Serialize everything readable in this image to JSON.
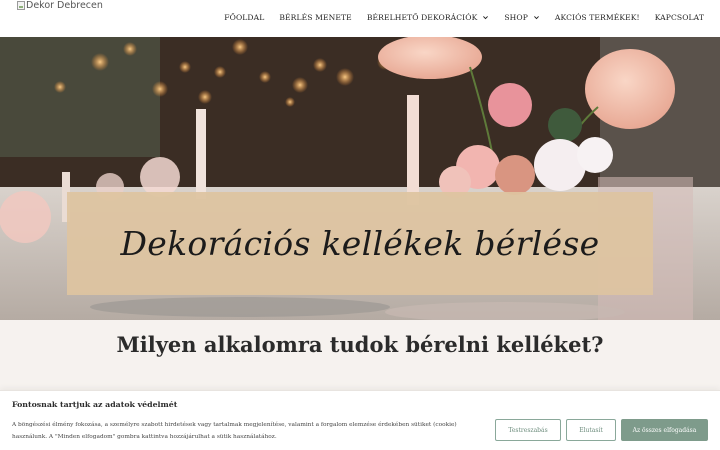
{
  "header": {
    "logo_alt": "Dekor Debrecen",
    "nav": [
      {
        "label": "FŐOLDAL",
        "dropdown": false
      },
      {
        "label": "BÉRLÉS MENETE",
        "dropdown": false
      },
      {
        "label": "BÉRELHETŐ DEKORÁCIÓK",
        "dropdown": true
      },
      {
        "label": "SHOP",
        "dropdown": true
      },
      {
        "label": "AKCIÓS TERMÉKEK!",
        "dropdown": false
      },
      {
        "label": "KAPCSOLAT",
        "dropdown": false
      }
    ]
  },
  "hero": {
    "title": "Dekorációs kellékek bérlése"
  },
  "section": {
    "title": "Milyen alkalomra tudok bérelni kelléket?"
  },
  "cookie": {
    "title": "Fontosnak tartjuk az adatok védelmét",
    "text": "A böngészési élmény fokozása, a személyre szabott hirdetések vagy tartalmak megjelenítése, valamint a forgalom elemzése érdekében sütiket (cookie) használunk. A \"Minden elfogadom\" gombra kattintva hozzájárulhat a sütik használatához.",
    "customize_label": "Testreszabás",
    "reject_label": "Elutasít",
    "accept_label": "Az összes elfogadása"
  },
  "colors": {
    "banner": "#dec4a0",
    "section_bg": "#f6f2ef",
    "accent_green": "#7e9b8b"
  }
}
